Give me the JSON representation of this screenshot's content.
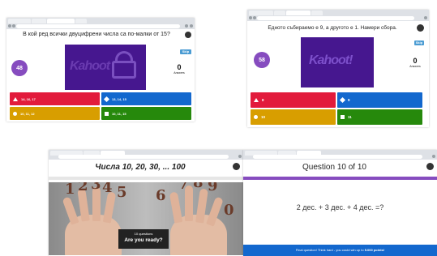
{
  "screen1": {
    "question": "В кой ред всички двуцифрени числа са по-малки от 15?",
    "timer": "48",
    "skip": "Skip",
    "answers_count": "0",
    "answers_label": "Answers",
    "media_word": "Kahoot",
    "options": [
      "14, 16, 17",
      "13, 14, 15",
      "10, 11, 12",
      "10, 11, 15"
    ]
  },
  "screen2": {
    "question": "Едното събираемо е 9, а другото е 1. Намери сбора.",
    "timer": "58",
    "skip": "Skip",
    "answers_count": "0",
    "answers_label": "Answers",
    "media_word": "Kahoot!",
    "options": [
      "8",
      "9",
      "10",
      "11"
    ]
  },
  "screen3": {
    "title": "Числа 10, 20, 30, ... 100",
    "ready_small": "10 questions",
    "ready_big": "Are you ready?",
    "digits": [
      "1",
      "2",
      "3",
      "4",
      "5",
      "6",
      "7",
      "8",
      "9",
      "0"
    ]
  },
  "screen4": {
    "header": "Question 10 of 10",
    "equation": "2 дес. + 3 дес. + 4 дес. =?",
    "footer_text": "Final question! Think hard - you could win up to ",
    "footer_points": "5.000 points!"
  }
}
